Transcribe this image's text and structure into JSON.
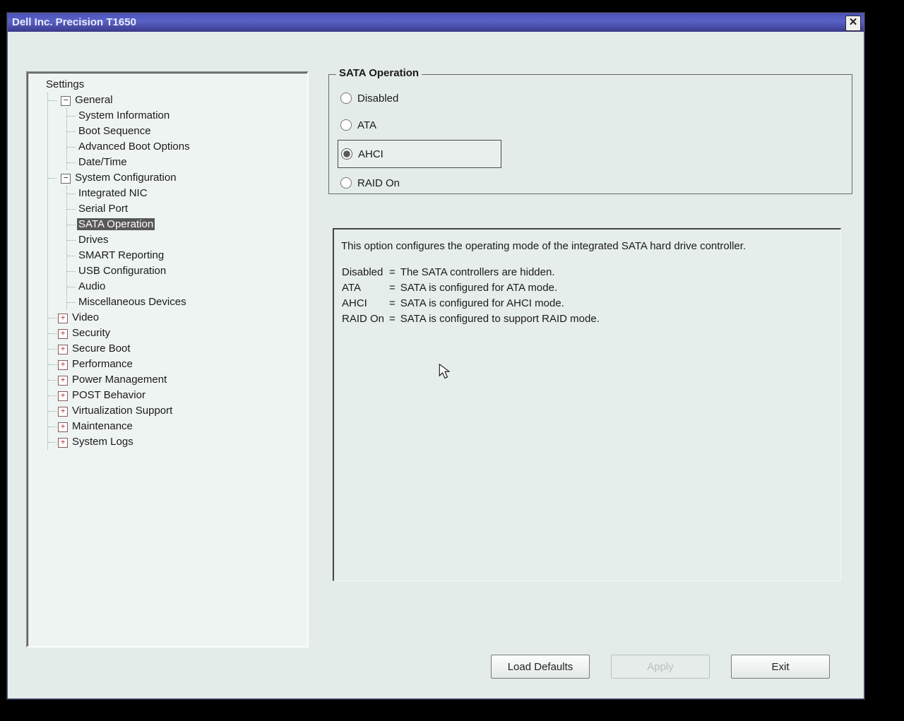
{
  "window": {
    "title": "Dell Inc. Precision T1650"
  },
  "tree": {
    "root_label": "Settings",
    "general": {
      "label": "General",
      "items": [
        "System Information",
        "Boot Sequence",
        "Advanced Boot Options",
        "Date/Time"
      ]
    },
    "sysconfig": {
      "label": "System Configuration",
      "items": [
        "Integrated NIC",
        "Serial Port",
        "SATA Operation",
        "Drives",
        "SMART Reporting",
        "USB Configuration",
        "Audio",
        "Miscellaneous Devices"
      ],
      "selected_index": 2
    },
    "collapsed": [
      "Video",
      "Security",
      "Secure Boot",
      "Performance",
      "Power Management",
      "POST Behavior",
      "Virtualization Support",
      "Maintenance",
      "System Logs"
    ]
  },
  "panel": {
    "title": "SATA Operation",
    "options": [
      "Disabled",
      "ATA",
      "AHCI",
      "RAID On"
    ],
    "selected_index": 2,
    "desc_intro": "This option configures the operating mode of the integrated SATA hard drive controller.",
    "desc_rows": [
      {
        "k": "Disabled",
        "v": "The SATA controllers are hidden."
      },
      {
        "k": "ATA",
        "v": "SATA is configured for ATA mode."
      },
      {
        "k": "AHCI",
        "v": "SATA is configured for AHCI mode."
      },
      {
        "k": "RAID On",
        "v": "SATA is configured to support RAID mode."
      }
    ]
  },
  "buttons": {
    "load_defaults": "Load Defaults",
    "apply": "Apply",
    "exit": "Exit"
  }
}
